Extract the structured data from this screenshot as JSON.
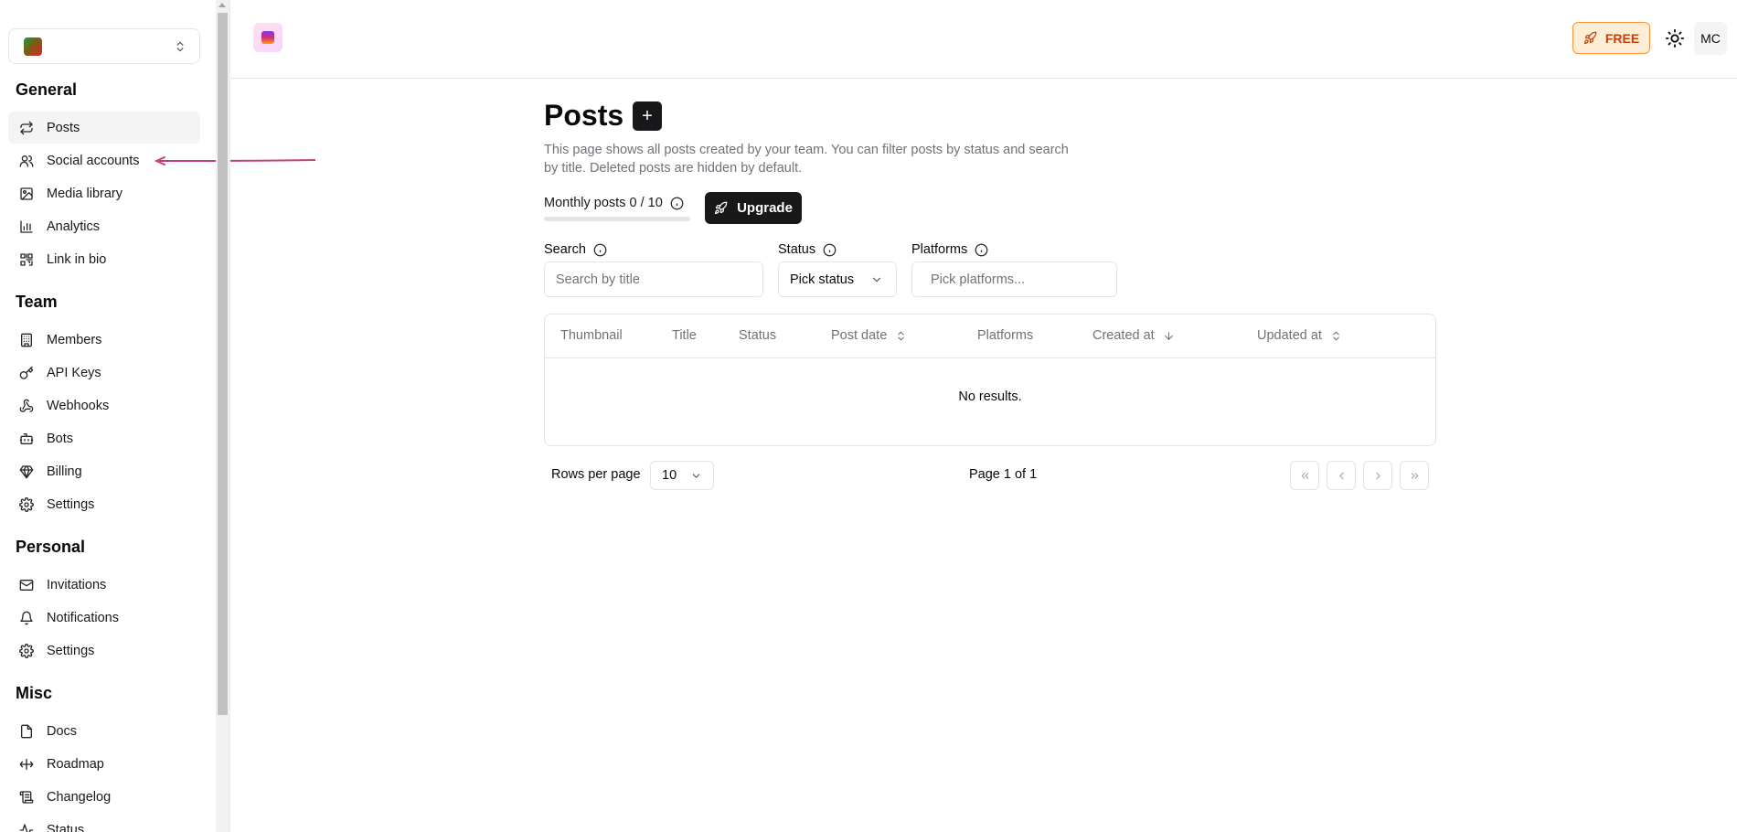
{
  "sidebar": {
    "team": [
      "Members",
      "API Keys",
      "Webhooks",
      "Bots",
      "Billing",
      "Settings"
    ],
    "sections": [
      {
        "title": "General"
      },
      {
        "title": "Team"
      },
      {
        "title": "Personal"
      },
      {
        "title": "Misc"
      }
    ],
    "general": [
      "Posts",
      "Social accounts",
      "Media library",
      "Analytics",
      "Link in bio"
    ],
    "personal": [
      "Invitations",
      "Notifications",
      "Settings"
    ],
    "misc": [
      "Docs",
      "Roadmap",
      "Changelog",
      "Status"
    ],
    "active_item": "Posts"
  },
  "header": {
    "plan_label": "FREE",
    "avatar_initials": "MC"
  },
  "main": {
    "title": "Posts",
    "add_label": "+",
    "description": "This page shows all posts created by your team. You can filter posts by status and search by title. Deleted posts are hidden by default.",
    "monthly_posts": "Monthly posts 0 / 10",
    "monthly_used": 0,
    "monthly_limit": 10,
    "upgrade_label": "Upgrade",
    "filters": {
      "search_label": "Search",
      "search_placeholder": "Search by title",
      "status_label": "Status",
      "status_value": "Pick status",
      "platforms_label": "Platforms",
      "platforms_placeholder": "Pick platforms..."
    },
    "table": {
      "columns": [
        "Thumbnail",
        "Title",
        "Status",
        "Post date",
        "Platforms",
        "Created at",
        "Updated at"
      ],
      "empty_text": "No results."
    },
    "pagination": {
      "rows_label": "Rows per page",
      "rows_value": "10",
      "page_info": "Page 1 of 1"
    }
  },
  "colors": {
    "accent": "#18181b",
    "plan_badge_bg": "#ffedd5",
    "plan_badge_text": "#c2410c",
    "annotation_arrow": "#c2407f"
  },
  "icons": {
    "general": [
      "repeat-icon",
      "users-icon",
      "image-icon",
      "bar-chart-icon",
      "qr-code-icon"
    ],
    "team": [
      "building-icon",
      "key-icon",
      "webhook-icon",
      "bot-icon",
      "gem-icon",
      "gear-icon"
    ],
    "personal": [
      "mail-icon",
      "bell-icon",
      "gear-icon"
    ],
    "misc": [
      "file-icon",
      "milestone-icon",
      "scroll-icon",
      "activity-icon"
    ]
  }
}
